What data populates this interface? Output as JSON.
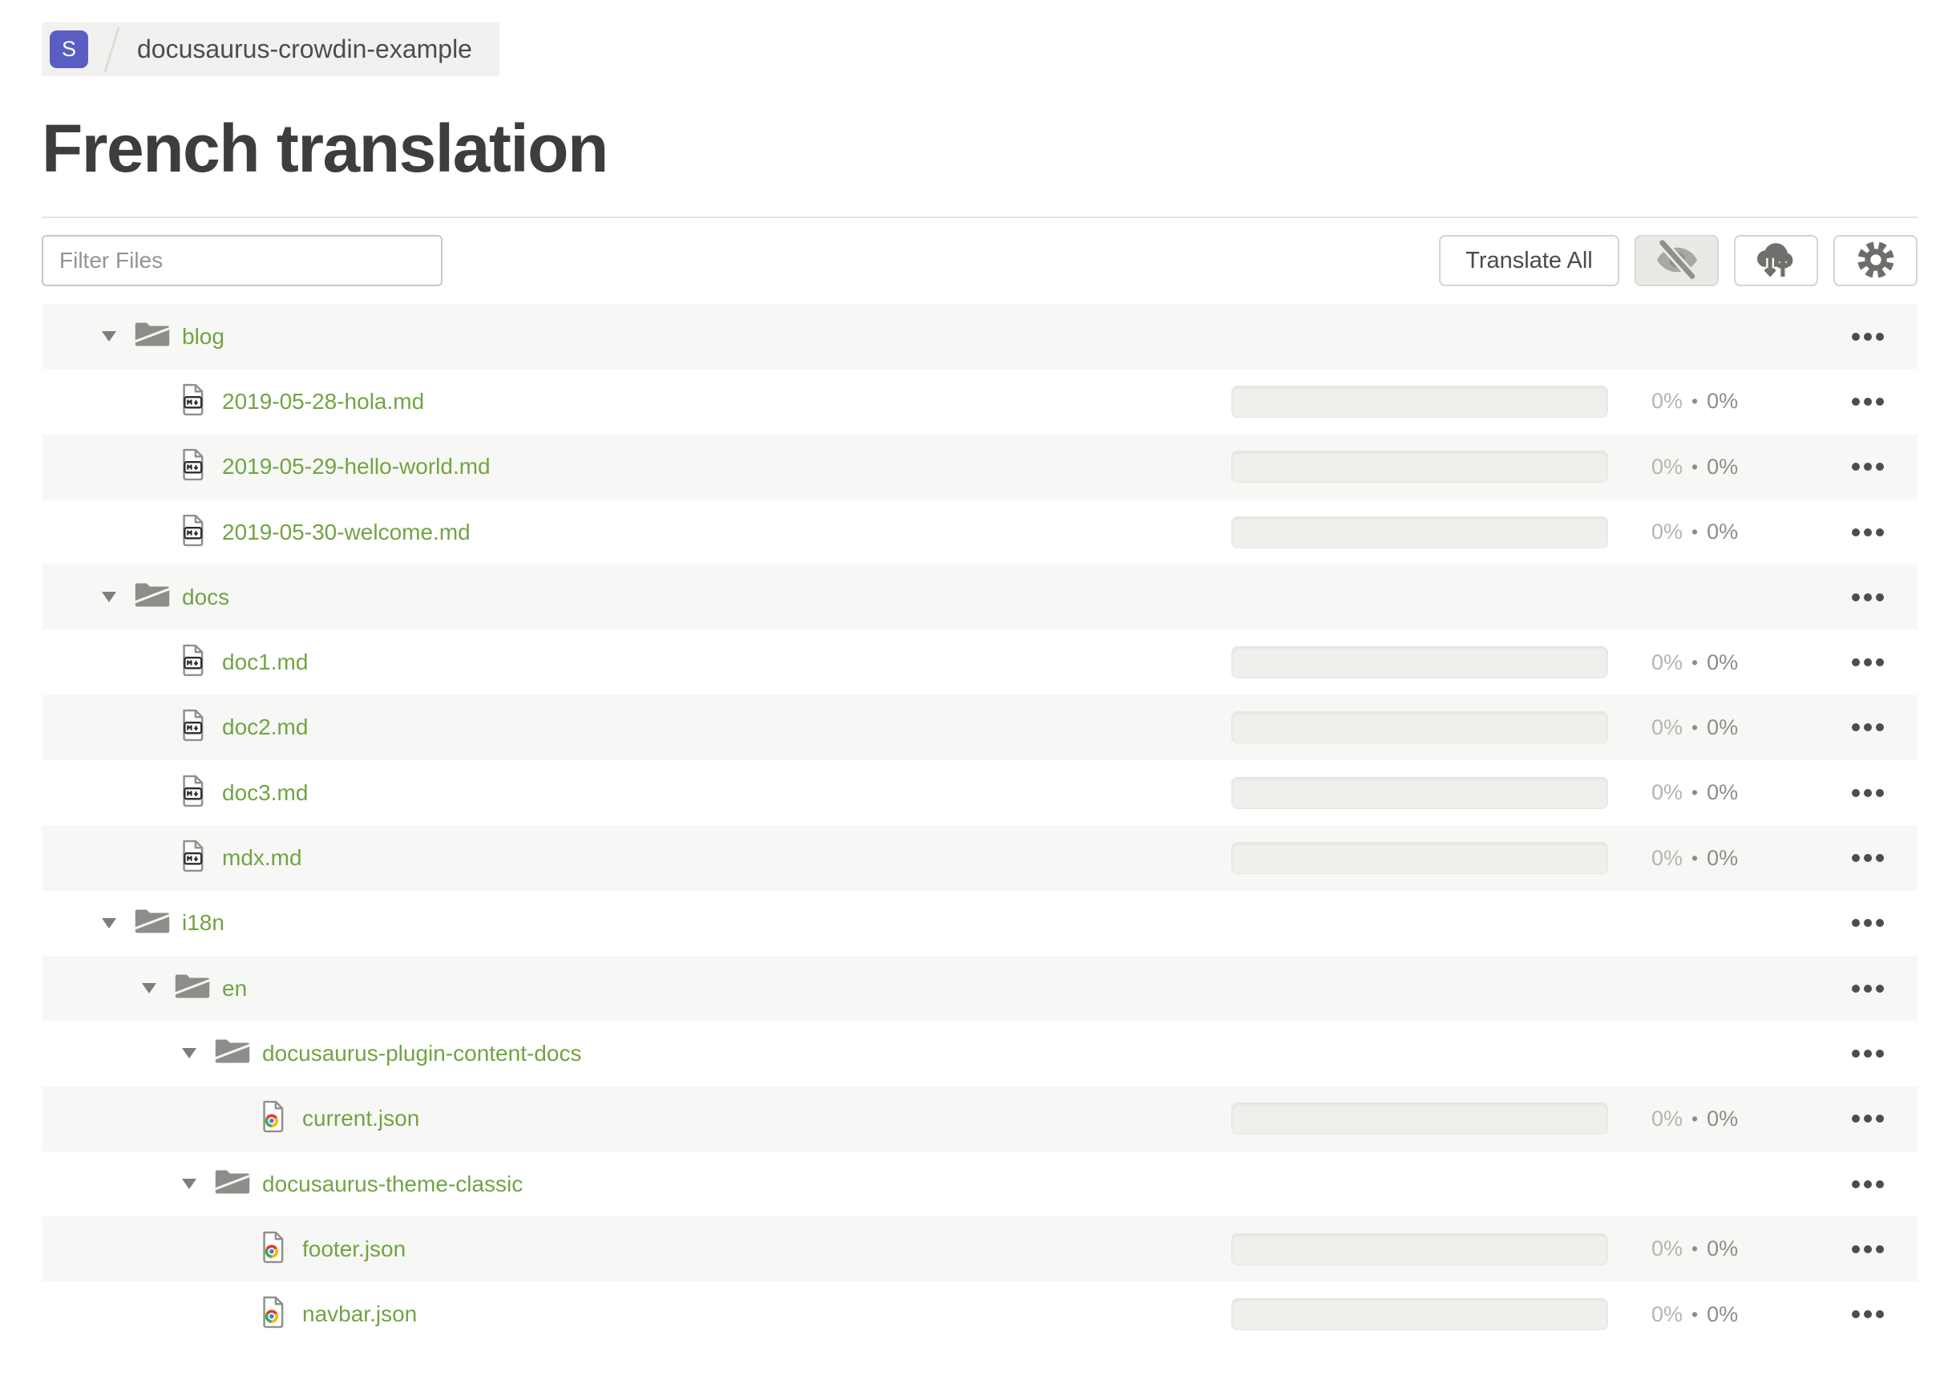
{
  "breadcrumb": {
    "badge_letter": "S",
    "project": "docusaurus-crowdin-example"
  },
  "page": {
    "title": "French translation"
  },
  "toolbar": {
    "filter_placeholder": "Filter Files",
    "translate_all_label": "Translate All",
    "icon_buttons": [
      {
        "name": "toggle-hidden-files",
        "icon": "eye-off-icon",
        "active": true
      },
      {
        "name": "download-upload",
        "icon": "cloud-download-upload-icon",
        "active": false
      },
      {
        "name": "settings",
        "icon": "gear-icon",
        "active": false
      }
    ]
  },
  "colors": {
    "badge_bg": "#5a5ec2",
    "link_green": "#72a444",
    "row_stripe": "#f7f7f5",
    "icon_gray": "#8d8d89"
  },
  "tree": {
    "progress_separator": "•",
    "rows": [
      {
        "type": "folder",
        "name": "blog",
        "level": 0,
        "expanded": true
      },
      {
        "type": "file",
        "icon": "markdown",
        "name": "2019-05-28-hola.md",
        "level": 1,
        "translated": "0%",
        "approved": "0%"
      },
      {
        "type": "file",
        "icon": "markdown",
        "name": "2019-05-29-hello-world.md",
        "level": 1,
        "translated": "0%",
        "approved": "0%"
      },
      {
        "type": "file",
        "icon": "markdown",
        "name": "2019-05-30-welcome.md",
        "level": 1,
        "translated": "0%",
        "approved": "0%"
      },
      {
        "type": "folder",
        "name": "docs",
        "level": 0,
        "expanded": true
      },
      {
        "type": "file",
        "icon": "markdown",
        "name": "doc1.md",
        "level": 1,
        "translated": "0%",
        "approved": "0%"
      },
      {
        "type": "file",
        "icon": "markdown",
        "name": "doc2.md",
        "level": 1,
        "translated": "0%",
        "approved": "0%"
      },
      {
        "type": "file",
        "icon": "markdown",
        "name": "doc3.md",
        "level": 1,
        "translated": "0%",
        "approved": "0%"
      },
      {
        "type": "file",
        "icon": "markdown",
        "name": "mdx.md",
        "level": 1,
        "translated": "0%",
        "approved": "0%"
      },
      {
        "type": "folder",
        "name": "i18n",
        "level": 0,
        "expanded": true
      },
      {
        "type": "folder",
        "name": "en",
        "level": 1,
        "expanded": true
      },
      {
        "type": "folder",
        "name": "docusaurus-plugin-content-docs",
        "level": 2,
        "expanded": true
      },
      {
        "type": "file",
        "icon": "json",
        "name": "current.json",
        "level": 3,
        "translated": "0%",
        "approved": "0%"
      },
      {
        "type": "folder",
        "name": "docusaurus-theme-classic",
        "level": 2,
        "expanded": true
      },
      {
        "type": "file",
        "icon": "json",
        "name": "footer.json",
        "level": 3,
        "translated": "0%",
        "approved": "0%"
      },
      {
        "type": "file",
        "icon": "json",
        "name": "navbar.json",
        "level": 3,
        "translated": "0%",
        "approved": "0%"
      }
    ]
  }
}
